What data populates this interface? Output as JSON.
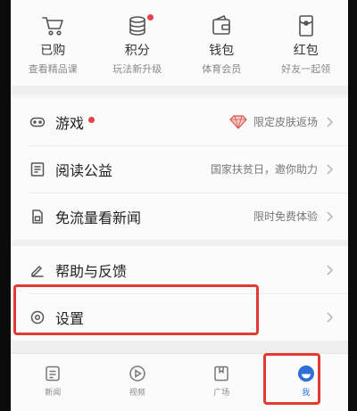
{
  "shortcuts": [
    {
      "title": "已购",
      "subtitle": "查看精品课",
      "icon": "cart-icon"
    },
    {
      "title": "积分",
      "subtitle": "玩法新升级",
      "icon": "coins-icon",
      "badge_dot": true
    },
    {
      "title": "钱包",
      "subtitle": "体育会员",
      "icon": "wallet-icon"
    },
    {
      "title": "红包",
      "subtitle": "好友一起领",
      "icon": "red-envelope-icon"
    }
  ],
  "menu": {
    "game": {
      "label": "游戏",
      "hint": "限定皮肤返场",
      "icon": "gamepad-icon",
      "badge_dot": true
    },
    "reading": {
      "label": "阅读公益",
      "hint": "国家扶贫日，邀你助力",
      "icon": "book-icon"
    },
    "free_data": {
      "label": "免流量看新闻",
      "hint": "限时免费体验",
      "icon": "sim-card-icon"
    },
    "help": {
      "label": "帮助与反馈",
      "hint": "",
      "icon": "pencil-icon"
    },
    "settings": {
      "label": "设置",
      "hint": "",
      "icon": "gear-icon"
    }
  },
  "tabs": [
    {
      "label": "新闻",
      "icon": "news-icon"
    },
    {
      "label": "视频",
      "icon": "play-icon"
    },
    {
      "label": "广场",
      "icon": "square-icon"
    },
    {
      "label": "我",
      "icon": "me-icon",
      "active": true
    }
  ],
  "colors": {
    "accent": "#2f6fd9",
    "badge": "#e8414c",
    "highlight_box": "#e23b2f"
  }
}
